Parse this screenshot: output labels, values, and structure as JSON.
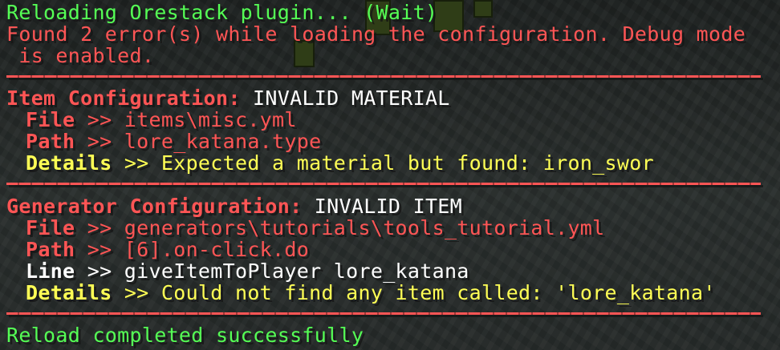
{
  "messages": {
    "reloading": "Reloading Orestack plugin... (Wait)",
    "errors_line1": "Found 2 error(s) while loading the configuration. Debug mode",
    "errors_line2": " is enabled.",
    "completed": "Reload completed successfully"
  },
  "errors": [
    {
      "title": "Item Configuration:",
      "type": " INVALID MATERIAL",
      "file_label": "File",
      "file_value": " >> items\\misc.yml",
      "path_label": "Path",
      "path_value": " >> lore_katana.type",
      "details_label": "Details",
      "details_value": " >> Expected a material but found: iron_swor"
    },
    {
      "title": "Generator Configuration:",
      "type": " INVALID ITEM",
      "file_label": "File",
      "file_value": " >> generators\\tutorials\\tools_tutorial.yml",
      "path_label": "Path",
      "path_value": " >> [6].on-click.do",
      "line_label": "Line",
      "line_value": " >> giveItemToPlayer lore_katana",
      "details_label": "Details",
      "details_value": " >> Could not find any item called: 'lore_katana'"
    }
  ],
  "colors": {
    "success": "#55ff55",
    "error": "#ff5555",
    "detail": "#ffff55",
    "text": "#ffffff"
  }
}
